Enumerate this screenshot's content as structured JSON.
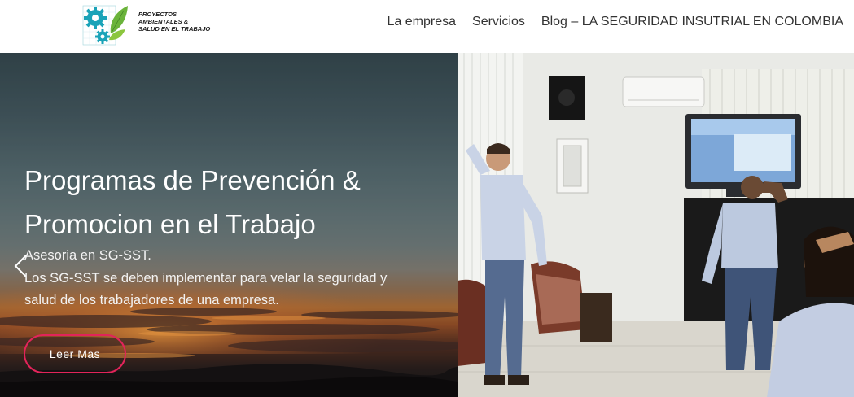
{
  "brand": {
    "logo_lines": [
      "PROYECTOS",
      "AMBIENTALES &",
      "SALUD EN EL TRABAJO"
    ],
    "colors": {
      "gear": "#1aa3b8",
      "leaf": "#6ab33a"
    }
  },
  "nav": {
    "items": [
      {
        "label": "La empresa"
      },
      {
        "label": "Servicios"
      },
      {
        "label": "Blog – LA SEGURIDAD INSUTRIAL EN COLOMBIA"
      }
    ]
  },
  "slider": {
    "title_line1": "Programas de Prevención &",
    "title_line2": "Promocion en el Trabajo",
    "subtitle_lines": [
      "Asesoria en SG-SST.",
      "Los SG-SST se deben implementar para velar la seguridad y",
      "salud de los trabajadores de una empresa."
    ],
    "button_label": "Leer Mas",
    "prev_icon": "chevron-left-icon",
    "accent_color": "#e2245a"
  }
}
